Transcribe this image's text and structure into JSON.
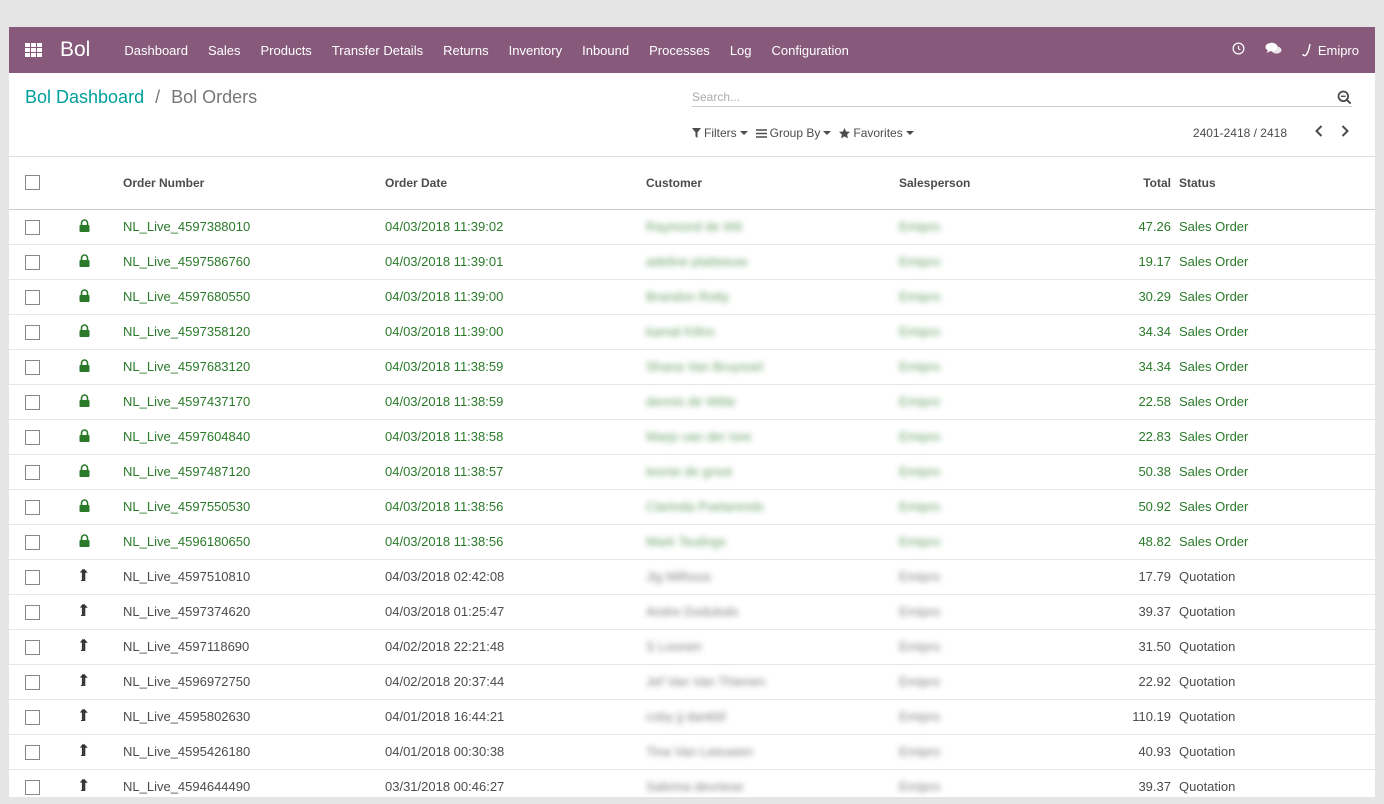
{
  "navbar": {
    "brand": "Bol",
    "menu": [
      "Dashboard",
      "Sales",
      "Products",
      "Transfer Details",
      "Returns",
      "Inventory",
      "Inbound",
      "Processes",
      "Log",
      "Configuration"
    ],
    "user": "Emipro",
    "bg_color": "#875a7b"
  },
  "breadcrumb": {
    "parent": "Bol Dashboard",
    "separator": "/",
    "current": "Bol Orders"
  },
  "search": {
    "placeholder": "Search..."
  },
  "filters": {
    "filters": "Filters",
    "group_by": "Group By",
    "favorites": "Favorites"
  },
  "pager": {
    "value": "2401-2418 / 2418"
  },
  "table": {
    "headers": {
      "order_number": "Order Number",
      "order_date": "Order Date",
      "customer": "Customer",
      "salesperson": "Salesperson",
      "total": "Total",
      "status": "Status"
    },
    "rows": [
      {
        "type": "sale",
        "icon": "lock-icon",
        "order": "NL_Live_4597388010",
        "date": "04/03/2018 11:39:02",
        "customer": "Raymond de Wit",
        "salesperson": "Emipro",
        "total": "47.26",
        "status": "Sales Order"
      },
      {
        "type": "sale",
        "icon": "lock-icon",
        "order": "NL_Live_4597586760",
        "date": "04/03/2018 11:39:01",
        "customer": "adeline platteeuw",
        "salesperson": "Emipro",
        "total": "19.17",
        "status": "Sales Order"
      },
      {
        "type": "sale",
        "icon": "lock-icon",
        "order": "NL_Live_4597680550",
        "date": "04/03/2018 11:39:00",
        "customer": "Brandon Rotty",
        "salesperson": "Emipro",
        "total": "30.29",
        "status": "Sales Order"
      },
      {
        "type": "sale",
        "icon": "lock-icon",
        "order": "NL_Live_4597358120",
        "date": "04/03/2018 11:39:00",
        "customer": "kamal Kilinc",
        "salesperson": "Emipro",
        "total": "34.34",
        "status": "Sales Order"
      },
      {
        "type": "sale",
        "icon": "lock-icon",
        "order": "NL_Live_4597683120",
        "date": "04/03/2018 11:38:59",
        "customer": "Shana Van Bruyssel",
        "salesperson": "Emipro",
        "total": "34.34",
        "status": "Sales Order"
      },
      {
        "type": "sale",
        "icon": "lock-icon",
        "order": "NL_Live_4597437170",
        "date": "04/03/2018 11:38:59",
        "customer": "dennis de Witte",
        "salesperson": "Emipro",
        "total": "22.58",
        "status": "Sales Order"
      },
      {
        "type": "sale",
        "icon": "lock-icon",
        "order": "NL_Live_4597604840",
        "date": "04/03/2018 11:38:58",
        "customer": "Marjo van der Iore",
        "salesperson": "Emipro",
        "total": "22.83",
        "status": "Sales Order"
      },
      {
        "type": "sale",
        "icon": "lock-icon",
        "order": "NL_Live_4597487120",
        "date": "04/03/2018 11:38:57",
        "customer": "leonie de groot",
        "salesperson": "Emipro",
        "total": "50.38",
        "status": "Sales Order"
      },
      {
        "type": "sale",
        "icon": "lock-icon",
        "order": "NL_Live_4597550530",
        "date": "04/03/2018 11:38:56",
        "customer": "Clarinda Poelarends",
        "salesperson": "Emipro",
        "total": "50.92",
        "status": "Sales Order"
      },
      {
        "type": "sale",
        "icon": "lock-icon",
        "order": "NL_Live_4596180650",
        "date": "04/03/2018 11:38:56",
        "customer": "Mark Teulings",
        "salesperson": "Emipro",
        "total": "48.82",
        "status": "Sales Order"
      },
      {
        "type": "quote",
        "icon": "level-up-icon",
        "order": "NL_Live_4597510810",
        "date": "04/03/2018 02:42:08",
        "customer": "Jig Milhous",
        "salesperson": "Emipro",
        "total": "17.79",
        "status": "Quotation"
      },
      {
        "type": "quote",
        "icon": "level-up-icon",
        "order": "NL_Live_4597374620",
        "date": "04/03/2018 01:25:47",
        "customer": "Andre Dodukals",
        "salesperson": "Emipro",
        "total": "39.37",
        "status": "Quotation"
      },
      {
        "type": "quote",
        "icon": "level-up-icon",
        "order": "NL_Live_4597118690",
        "date": "04/02/2018 22:21:48",
        "customer": "S Loonen",
        "salesperson": "Emipro",
        "total": "31.50",
        "status": "Quotation"
      },
      {
        "type": "quote",
        "icon": "level-up-icon",
        "order": "NL_Live_4596972750",
        "date": "04/02/2018 20:37:44",
        "customer": "Jef Van Van Thienen",
        "salesperson": "Emipro",
        "total": "22.92",
        "status": "Quotation"
      },
      {
        "type": "quote",
        "icon": "level-up-icon",
        "order": "NL_Live_4595802630",
        "date": "04/01/2018 16:44:21",
        "customer": "coby jj dankbf",
        "salesperson": "Emipro",
        "total": "110.19",
        "status": "Quotation"
      },
      {
        "type": "quote",
        "icon": "level-up-icon",
        "order": "NL_Live_4595426180",
        "date": "04/01/2018 00:30:38",
        "customer": "Tina Van Leeuwen",
        "salesperson": "Emipro",
        "total": "40.93",
        "status": "Quotation"
      },
      {
        "type": "quote",
        "icon": "level-up-icon",
        "order": "NL_Live_4594644490",
        "date": "03/31/2018 00:46:27",
        "customer": "Sabrina devriese",
        "salesperson": "Emipro",
        "total": "39.37",
        "status": "Quotation"
      }
    ]
  }
}
